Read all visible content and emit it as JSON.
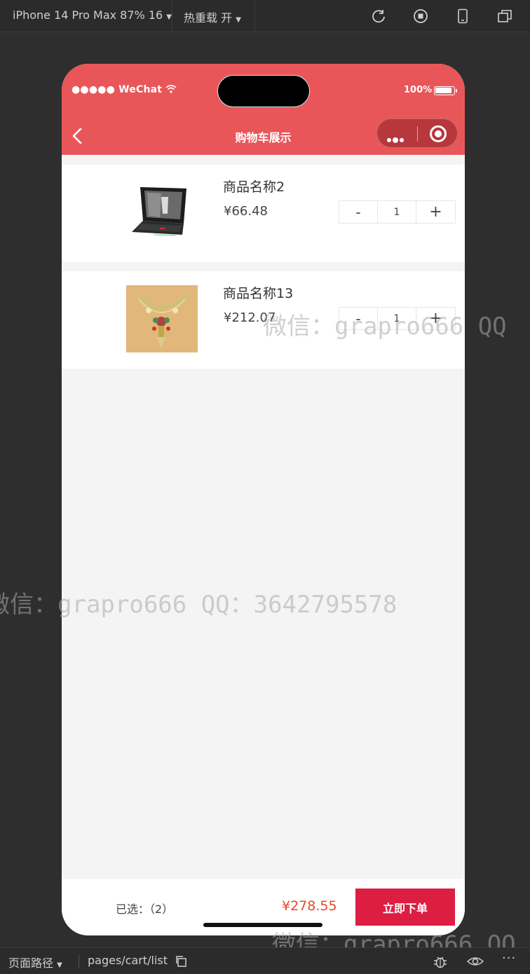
{
  "toolbar": {
    "device": "iPhone 14 Pro Max 87% 16",
    "hot_reload": "热重载 开",
    "icons": [
      "refresh-icon",
      "stop-icon",
      "phone-icon",
      "window-icon"
    ]
  },
  "status_bar": {
    "carrier": "●●●●● WeChat",
    "battery": "100%"
  },
  "nav": {
    "title": "购物车展示"
  },
  "cart": {
    "items": [
      {
        "name": "商品名称2",
        "price": "¥66.48",
        "qty": "1",
        "minus": "-",
        "plus": "+"
      },
      {
        "name": "商品名称13",
        "price": "¥212.07",
        "qty": "1",
        "minus": "-",
        "plus": "+"
      }
    ]
  },
  "footer": {
    "selected": "已选：（2）",
    "total": "¥278.55",
    "order_button": "立即下单"
  },
  "watermarks": {
    "w1": "微信：grapro666 QQ",
    "w2": "微信：grapro666 QQ：3642795578",
    "w3": "微信：grapro666 QQ"
  },
  "bottom_strip": {
    "page_path_label": "页面路径",
    "path": "pages/cart/list"
  }
}
